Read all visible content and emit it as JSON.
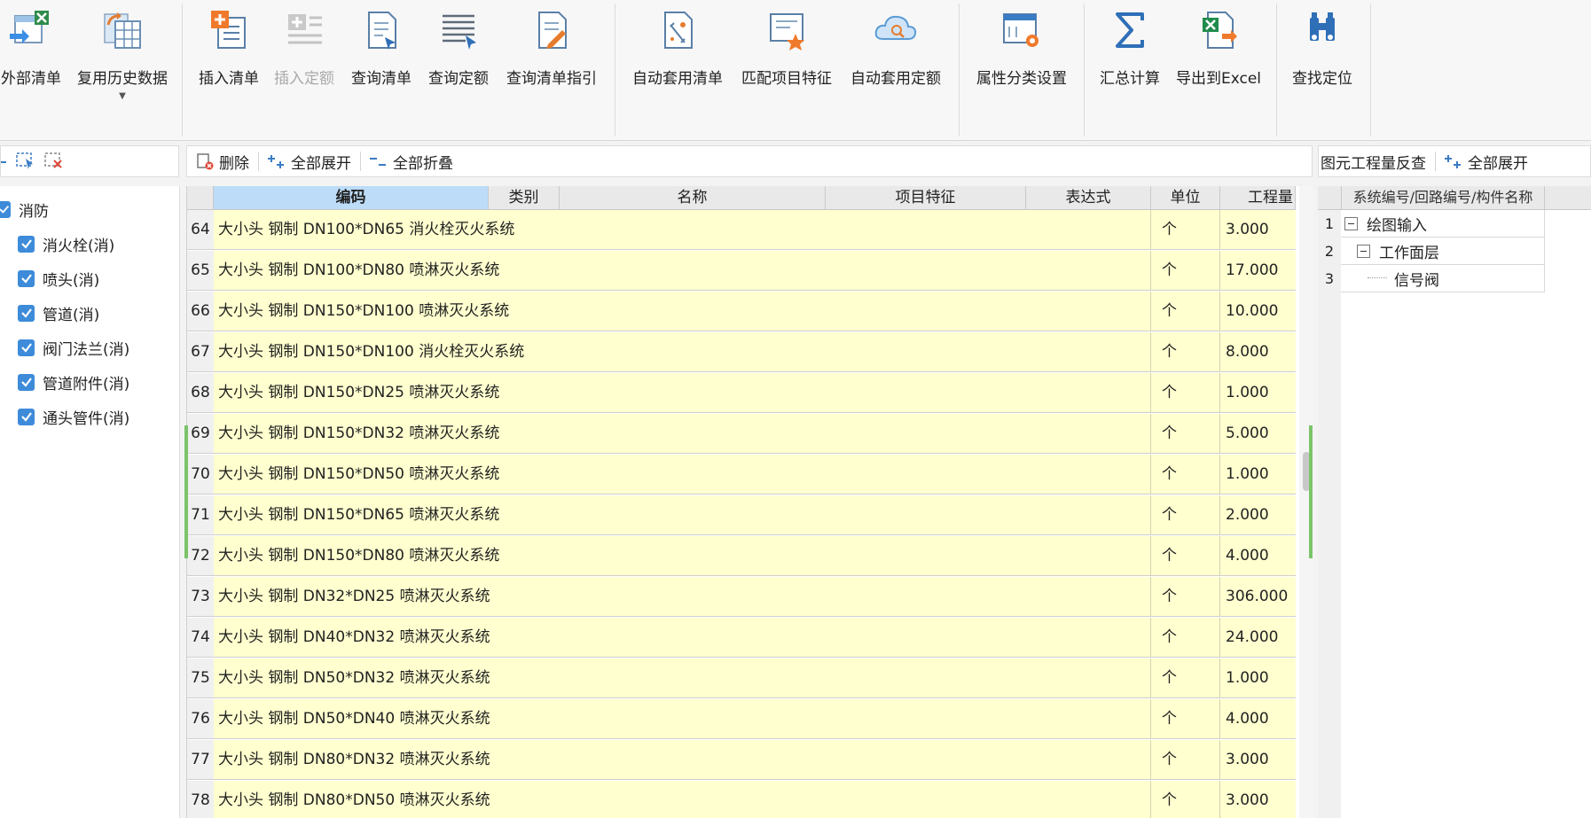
{
  "ribbon": {
    "buttons": [
      {
        "label": "外部清单",
        "icon": "external-list-icon"
      },
      {
        "label": "复用历史数据",
        "icon": "reuse-history-icon"
      },
      {
        "label": "插入清单",
        "icon": "insert-list-icon"
      },
      {
        "label": "插入定额",
        "icon": "insert-quota-icon",
        "disabled": true
      },
      {
        "label": "查询清单",
        "icon": "query-list-icon"
      },
      {
        "label": "查询定额",
        "icon": "query-quota-icon"
      },
      {
        "label": "查询清单指引",
        "icon": "list-guide-icon"
      },
      {
        "label": "自动套用清单",
        "icon": "auto-apply-list-icon"
      },
      {
        "label": "匹配项目特征",
        "icon": "match-feature-icon"
      },
      {
        "label": "自动套用定额",
        "icon": "auto-apply-quota-cloud-icon"
      },
      {
        "label": "属性分类设置",
        "icon": "property-settings-icon"
      },
      {
        "label": "汇总计算",
        "icon": "sigma-icon"
      },
      {
        "label": "导出到Excel",
        "icon": "excel-export-icon"
      },
      {
        "label": "查找定位",
        "icon": "binoculars-icon"
      }
    ]
  },
  "left": {
    "root": "消防",
    "items": [
      "消火栓(消)",
      "喷头(消)",
      "管道(消)",
      "阀门法兰(消)",
      "管道附件(消)",
      "通头管件(消)"
    ]
  },
  "center_toolbar": {
    "delete": "删除",
    "expand_all": "全部展开",
    "collapse_all": "全部折叠"
  },
  "grid": {
    "headers": {
      "code": "编码",
      "type": "类别",
      "name": "名称",
      "feature": "项目特征",
      "expr": "表达式",
      "unit": "单位",
      "qty": "工程量"
    },
    "rows": [
      {
        "n": "64",
        "text": "大小头 钢制 DN100*DN65 消火栓灭火系统",
        "unit": "个",
        "qty": "3.000"
      },
      {
        "n": "65",
        "text": "大小头 钢制 DN100*DN80 喷淋灭火系统",
        "unit": "个",
        "qty": "17.000"
      },
      {
        "n": "66",
        "text": "大小头 钢制 DN150*DN100 喷淋灭火系统",
        "unit": "个",
        "qty": "10.000"
      },
      {
        "n": "67",
        "text": "大小头 钢制 DN150*DN100 消火栓灭火系统",
        "unit": "个",
        "qty": "8.000"
      },
      {
        "n": "68",
        "text": "大小头 钢制 DN150*DN25 喷淋灭火系统",
        "unit": "个",
        "qty": "1.000"
      },
      {
        "n": "69",
        "text": "大小头 钢制 DN150*DN32 喷淋灭火系统",
        "unit": "个",
        "qty": "5.000"
      },
      {
        "n": "70",
        "text": "大小头 钢制 DN150*DN50 喷淋灭火系统",
        "unit": "个",
        "qty": "1.000"
      },
      {
        "n": "71",
        "text": "大小头 钢制 DN150*DN65 喷淋灭火系统",
        "unit": "个",
        "qty": "2.000"
      },
      {
        "n": "72",
        "text": "大小头 钢制 DN150*DN80 喷淋灭火系统",
        "unit": "个",
        "qty": "4.000"
      },
      {
        "n": "73",
        "text": "大小头 钢制 DN32*DN25 喷淋灭火系统",
        "unit": "个",
        "qty": "306.000"
      },
      {
        "n": "74",
        "text": "大小头 钢制 DN40*DN32 喷淋灭火系统",
        "unit": "个",
        "qty": "24.000"
      },
      {
        "n": "75",
        "text": "大小头 钢制 DN50*DN32 喷淋灭火系统",
        "unit": "个",
        "qty": "1.000"
      },
      {
        "n": "76",
        "text": "大小头 钢制 DN50*DN40 喷淋灭火系统",
        "unit": "个",
        "qty": "4.000"
      },
      {
        "n": "77",
        "text": "大小头 钢制 DN80*DN32 喷淋灭火系统",
        "unit": "个",
        "qty": "3.000"
      },
      {
        "n": "78",
        "text": "大小头 钢制 DN80*DN50 喷淋灭火系统",
        "unit": "个",
        "qty": "3.000"
      }
    ]
  },
  "right": {
    "title": "图元工程量反查",
    "expand_all": "全部展开",
    "header": "系统编号/回路编号/构件名称",
    "tree": [
      {
        "n": "1",
        "label": "绘图输入"
      },
      {
        "n": "2",
        "label": "工作面层"
      },
      {
        "n": "3",
        "label": "信号阀"
      }
    ]
  },
  "colors": {
    "row_highlight": "#ffffcf",
    "code_header_selected": "#bcdcf8",
    "checkbox": "#3d8bd9",
    "splitter_accent": "#7cc46a"
  }
}
